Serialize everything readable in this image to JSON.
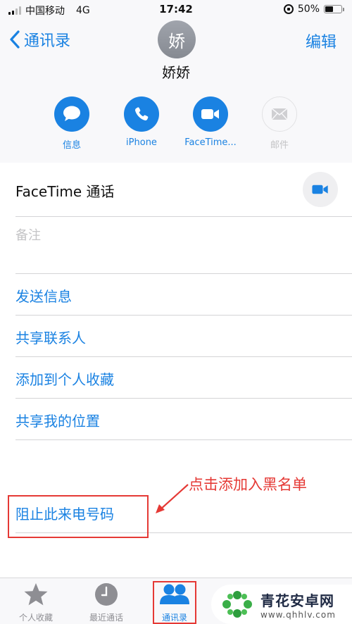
{
  "status_bar": {
    "carrier": "中国移动",
    "network": "4G",
    "time": "17:42",
    "battery_text": "50%",
    "battery_level": 0.5
  },
  "nav": {
    "back_label": "通讯录",
    "edit_label": "编辑"
  },
  "contact": {
    "avatar_initial": "娇",
    "name": "娇娇"
  },
  "actions": [
    {
      "label": "信息",
      "icon": "message-icon",
      "enabled": true
    },
    {
      "label": "iPhone",
      "icon": "phone-icon",
      "enabled": true
    },
    {
      "label": "FaceTime...",
      "icon": "video-icon",
      "enabled": true
    },
    {
      "label": "邮件",
      "icon": "mail-icon",
      "enabled": false
    }
  ],
  "facetime_row": {
    "label": "FaceTime 通话"
  },
  "notes": {
    "placeholder": "备注"
  },
  "options": [
    {
      "label": "发送信息"
    },
    {
      "label": "共享联系人"
    },
    {
      "label": "添加到个人收藏"
    },
    {
      "label": "共享我的位置"
    }
  ],
  "block": {
    "label": "阻止此来电号码"
  },
  "annotation": {
    "text": "点击添加入黑名单",
    "color": "#e53935"
  },
  "tabbar": {
    "tabs": [
      {
        "label": "个人收藏",
        "icon": "star-icon",
        "active": false
      },
      {
        "label": "最近通话",
        "icon": "clock-icon",
        "active": false
      },
      {
        "label": "通讯录",
        "icon": "contacts-icon",
        "active": true
      }
    ]
  },
  "watermark": {
    "title": "青花安卓网",
    "url": "www.qhhlv.com"
  },
  "colors": {
    "accent": "#1a82e2",
    "annotation": "#e53935",
    "watermark_green": "#2e9e3e"
  }
}
